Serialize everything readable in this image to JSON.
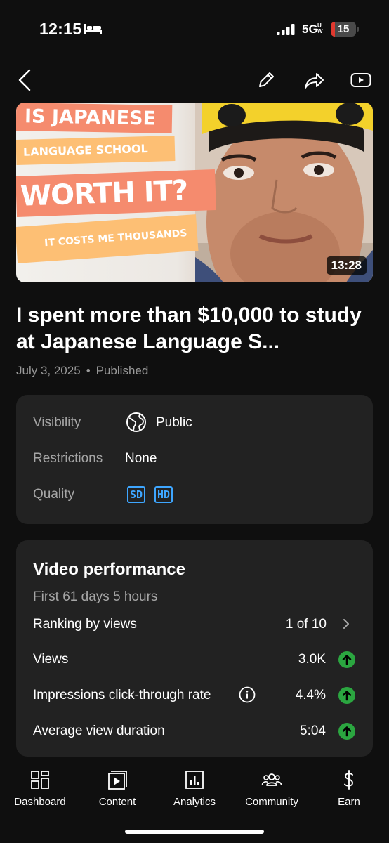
{
  "status_bar": {
    "time": "12:15",
    "network": "5G",
    "network_sub": "UW",
    "battery": "15",
    "battery_level": 0.15,
    "sleep_icon": "bed-icon",
    "signal_icon": "signal-bars-icon"
  },
  "header": {
    "back_icon": "chevron-left-icon",
    "edit_icon": "pencil-icon",
    "share_icon": "share-arrow-icon",
    "youtube_icon": "youtube-play-icon"
  },
  "video": {
    "thumbnail_text": {
      "line1": "IS JAPANESE",
      "line2": "LANGUAGE SCHOOL",
      "line3": "WORTH IT?",
      "line4": "IT COSTS ME THOUSANDS"
    },
    "duration": "13:28",
    "title": "I spent more than $10,000 to study at Japanese Language S...",
    "date": "July 3, 2025",
    "separator": "•",
    "status": "Published"
  },
  "details": {
    "visibility_label": "Visibility",
    "visibility_value": "Public",
    "visibility_icon": "globe-icon",
    "restrictions_label": "Restrictions",
    "restrictions_value": "None",
    "quality_label": "Quality",
    "quality_badges": [
      "SD",
      "HD"
    ]
  },
  "performance": {
    "title": "Video performance",
    "subtitle": "First 61 days 5 hours",
    "rows": [
      {
        "label": "Ranking by views",
        "value": "1 of 10",
        "icon": "chevron-right-icon"
      },
      {
        "label": "Views",
        "value": "3.0K",
        "icon": "trend-up-icon"
      },
      {
        "label": "Impressions click-through rate",
        "value": "4.4%",
        "icon": "trend-up-icon",
        "info_icon": "info-icon"
      },
      {
        "label": "Average view duration",
        "value": "5:04",
        "icon": "trend-up-icon"
      }
    ],
    "accent_color": "#2ba640"
  },
  "bottom_nav": {
    "items": [
      {
        "label": "Dashboard",
        "icon": "dashboard-icon"
      },
      {
        "label": "Content",
        "icon": "content-play-icon"
      },
      {
        "label": "Analytics",
        "icon": "analytics-icon"
      },
      {
        "label": "Community",
        "icon": "community-icon"
      },
      {
        "label": "Earn",
        "icon": "dollar-icon"
      }
    ]
  }
}
